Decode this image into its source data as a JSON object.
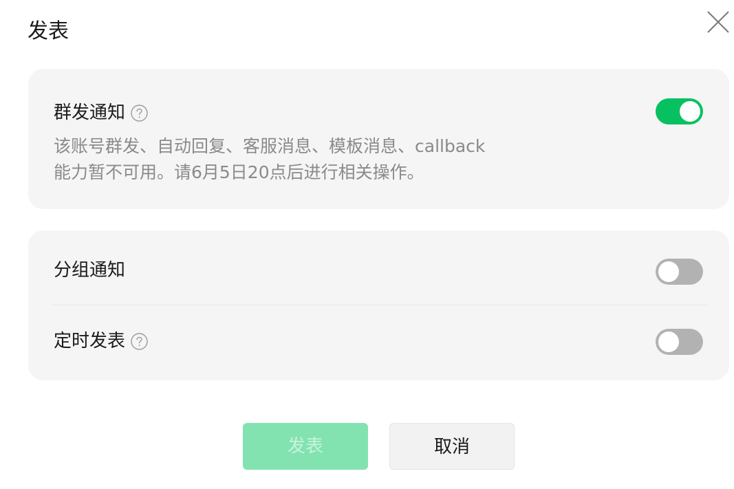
{
  "dialog": {
    "title": "发表"
  },
  "mass_notify": {
    "label": "群发通知",
    "description": "该账号群发、自动回复、客服消息、模板消息、callback能力暂不可用。请6月5日20点后进行相关操作。",
    "enabled": true
  },
  "group_notify": {
    "label": "分组通知",
    "enabled": false
  },
  "scheduled_publish": {
    "label": "定时发表",
    "enabled": false
  },
  "buttons": {
    "publish_label": "发表",
    "cancel_label": "取消"
  },
  "colors": {
    "accent": "#07c160",
    "accent_disabled": "#82e3b0",
    "card_bg": "#f5f5f5",
    "toggle_off": "#b2b2b2"
  },
  "icons": {
    "close": "close-icon",
    "help": "help-icon"
  }
}
